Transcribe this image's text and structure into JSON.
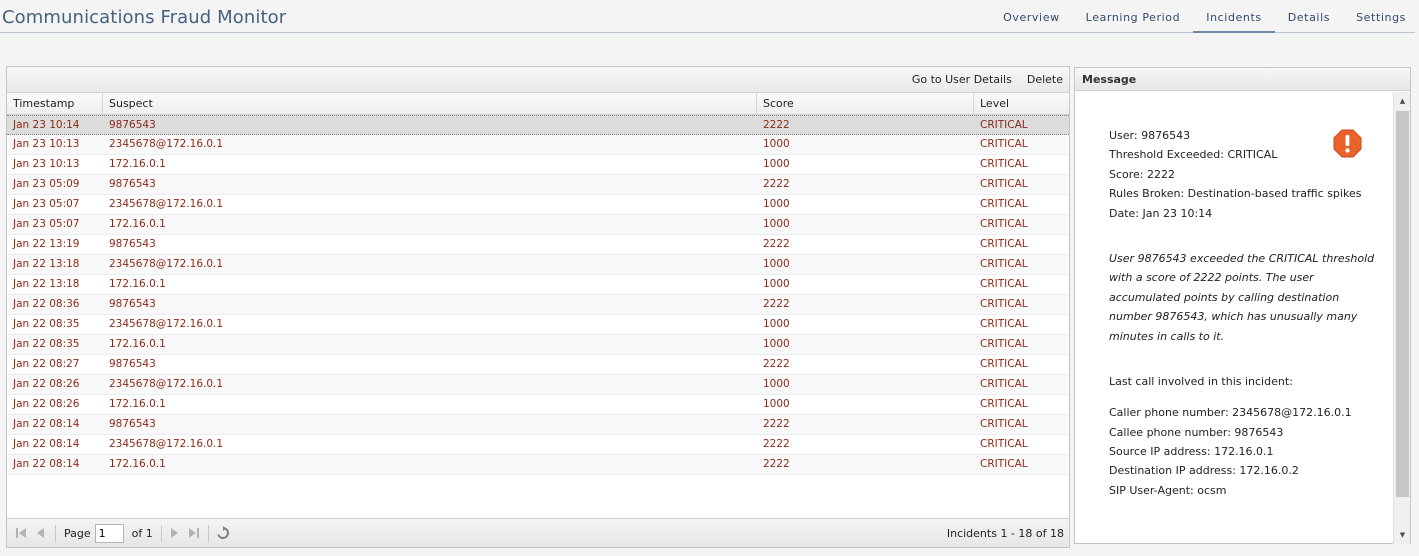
{
  "app": {
    "title": "Communications Fraud Monitor"
  },
  "nav": {
    "tabs": [
      {
        "label": "Overview",
        "active": false
      },
      {
        "label": "Learning Period",
        "active": false
      },
      {
        "label": "Incidents",
        "active": true
      },
      {
        "label": "Details",
        "active": false
      },
      {
        "label": "Settings",
        "active": false
      }
    ]
  },
  "grid": {
    "toolbar": {
      "go_to_user_details": "Go to User Details",
      "delete": "Delete"
    },
    "columns": [
      "Timestamp",
      "Suspect",
      "Score",
      "Level"
    ],
    "selected_index": 0,
    "rows": [
      [
        "Jan 23 10:14",
        "9876543",
        "2222",
        "CRITICAL"
      ],
      [
        "Jan 23 10:13",
        "2345678@172.16.0.1",
        "1000",
        "CRITICAL"
      ],
      [
        "Jan 23 10:13",
        "172.16.0.1",
        "1000",
        "CRITICAL"
      ],
      [
        "Jan 23 05:09",
        "9876543",
        "2222",
        "CRITICAL"
      ],
      [
        "Jan 23 05:07",
        "2345678@172.16.0.1",
        "1000",
        "CRITICAL"
      ],
      [
        "Jan 23 05:07",
        "172.16.0.1",
        "1000",
        "CRITICAL"
      ],
      [
        "Jan 22 13:19",
        "9876543",
        "2222",
        "CRITICAL"
      ],
      [
        "Jan 22 13:18",
        "2345678@172.16.0.1",
        "1000",
        "CRITICAL"
      ],
      [
        "Jan 22 13:18",
        "172.16.0.1",
        "1000",
        "CRITICAL"
      ],
      [
        "Jan 22 08:36",
        "9876543",
        "2222",
        "CRITICAL"
      ],
      [
        "Jan 22 08:35",
        "2345678@172.16.0.1",
        "1000",
        "CRITICAL"
      ],
      [
        "Jan 22 08:35",
        "172.16.0.1",
        "1000",
        "CRITICAL"
      ],
      [
        "Jan 22 08:27",
        "9876543",
        "2222",
        "CRITICAL"
      ],
      [
        "Jan 22 08:26",
        "2345678@172.16.0.1",
        "1000",
        "CRITICAL"
      ],
      [
        "Jan 22 08:26",
        "172.16.0.1",
        "1000",
        "CRITICAL"
      ],
      [
        "Jan 22 08:14",
        "9876543",
        "2222",
        "CRITICAL"
      ],
      [
        "Jan 22 08:14",
        "2345678@172.16.0.1",
        "2222",
        "CRITICAL"
      ],
      [
        "Jan 22 08:14",
        "172.16.0.1",
        "2222",
        "CRITICAL"
      ]
    ],
    "pager": {
      "page_label": "Page",
      "page_value": "1",
      "of_label": "of 1",
      "count_label": "Incidents 1 - 18 of 18"
    }
  },
  "message": {
    "title": "Message",
    "icon": "critical-alert-icon",
    "alert_color": "#e8622a",
    "summary": [
      "User: 9876543",
      "Threshold Exceeded: CRITICAL",
      "Score: 2222",
      "Rules Broken: Destination-based traffic spikes",
      "Date: Jan 23 10:14"
    ],
    "explanation": [
      "User 9876543 exceeded the CRITICAL threshold",
      "with a score of 2222 points. The user",
      "accumulated points by calling destination",
      "number 9876543, which has unusually many",
      "minutes in calls to it."
    ],
    "last_call_heading": "Last call involved in this incident:",
    "last_call": [
      "Caller phone number: 2345678@172.16.0.1",
      "Callee phone number: 9876543",
      "Source IP address: 172.16.0.1",
      "Destination IP address: 172.16.0.2",
      "SIP User-Agent: ocsm"
    ]
  }
}
